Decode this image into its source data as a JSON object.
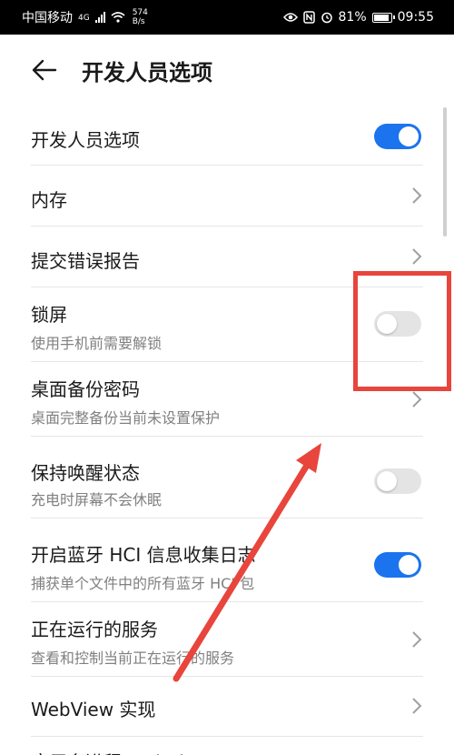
{
  "status_bar": {
    "carrier": "中国移动",
    "network": "4G",
    "speed_value": "574",
    "speed_unit": "B/s",
    "battery": "81%",
    "time": "09:55"
  },
  "header": {
    "title": "开发人员选项"
  },
  "items": [
    {
      "label": "开发人员选项",
      "sub": "",
      "control": "toggle",
      "state": "on"
    },
    {
      "label": "内存",
      "sub": "",
      "control": "chevron"
    },
    {
      "label": "提交错误报告",
      "sub": "",
      "control": "chevron"
    },
    {
      "label": "锁屏",
      "sub": "使用手机前需要解锁",
      "control": "toggle",
      "state": "off"
    },
    {
      "label": "桌面备份密码",
      "sub": "桌面完整备份当前未设置保护",
      "control": "chevron"
    },
    {
      "label": "保持唤醒状态",
      "sub": "充电时屏幕不会休眠",
      "control": "toggle",
      "state": "off"
    },
    {
      "label": "开启蓝牙 HCI 信息收集日志",
      "sub": "捕获单个文件中的所有蓝牙 HCI 包",
      "control": "toggle",
      "state": "on"
    },
    {
      "label": "正在运行的服务",
      "sub": "查看和控制当前正在运行的服务",
      "control": "chevron"
    },
    {
      "label": "WebView 实现",
      "sub": "",
      "control": "chevron"
    },
    {
      "label": "应用多进程 WebView",
      "sub": "",
      "control": "none"
    }
  ],
  "colors": {
    "toggle_on": "#1b74ee",
    "toggle_off": "#e4e4e4",
    "annotation": "#e8453c"
  }
}
